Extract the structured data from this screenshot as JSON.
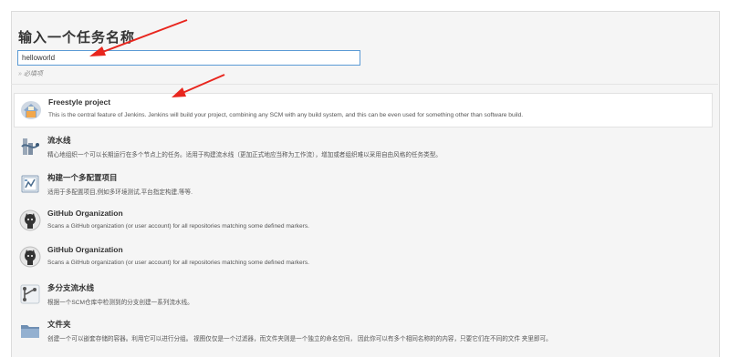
{
  "header": {
    "title": "输入一个任务名称"
  },
  "name_input": {
    "value": "helloworld"
  },
  "required_hint": {
    "mark": "»",
    "text": "必填项"
  },
  "items": [
    {
      "name": "Freestyle project",
      "desc": "This is the central feature of Jenkins. Jenkins will build your project, combining any SCM with any build system, and this can be even used for something other than software build.",
      "icon": "freestyle-project-icon"
    },
    {
      "name": "流水线",
      "desc": "精心地组织一个可以长期运行在多个节点上的任务。适用于构建流水线（更加正式地应当称为工作流），增加或者组织难以采用自由风格的任务类型。",
      "icon": "pipeline-icon"
    },
    {
      "name": "构建一个多配置项目",
      "desc": "适用于多配置项目,例如多环境测试,平台指定构建,等等.",
      "icon": "multi-config-icon"
    },
    {
      "name": "GitHub Organization",
      "desc": "Scans a GitHub organization (or user account) for all repositories matching some defined markers.",
      "icon": "github-octocat-icon"
    },
    {
      "name": "GitHub Organization",
      "desc": "Scans a GitHub organization (or user account) for all repositories matching some defined markers.",
      "icon": "github-octocat-icon"
    },
    {
      "name": "多分支流水线",
      "desc": "根据一个SCM仓库中检测到的分支创建一系列流水线。",
      "icon": "multibranch-pipeline-icon"
    },
    {
      "name": "文件夹",
      "desc": "创建一个可以嵌套存储的容器。利用它可以进行分组。 视图仅仅是一个过滤器，而文件夹则是一个独立的命名空间， 因此你可以有多个相同名称的的内容，只要它们在不同的文件 夹里即可。",
      "icon": "folder-icon"
    }
  ],
  "colors": {
    "annotation_arrow": "#e8261e",
    "input_border": "#5b9bd5"
  }
}
